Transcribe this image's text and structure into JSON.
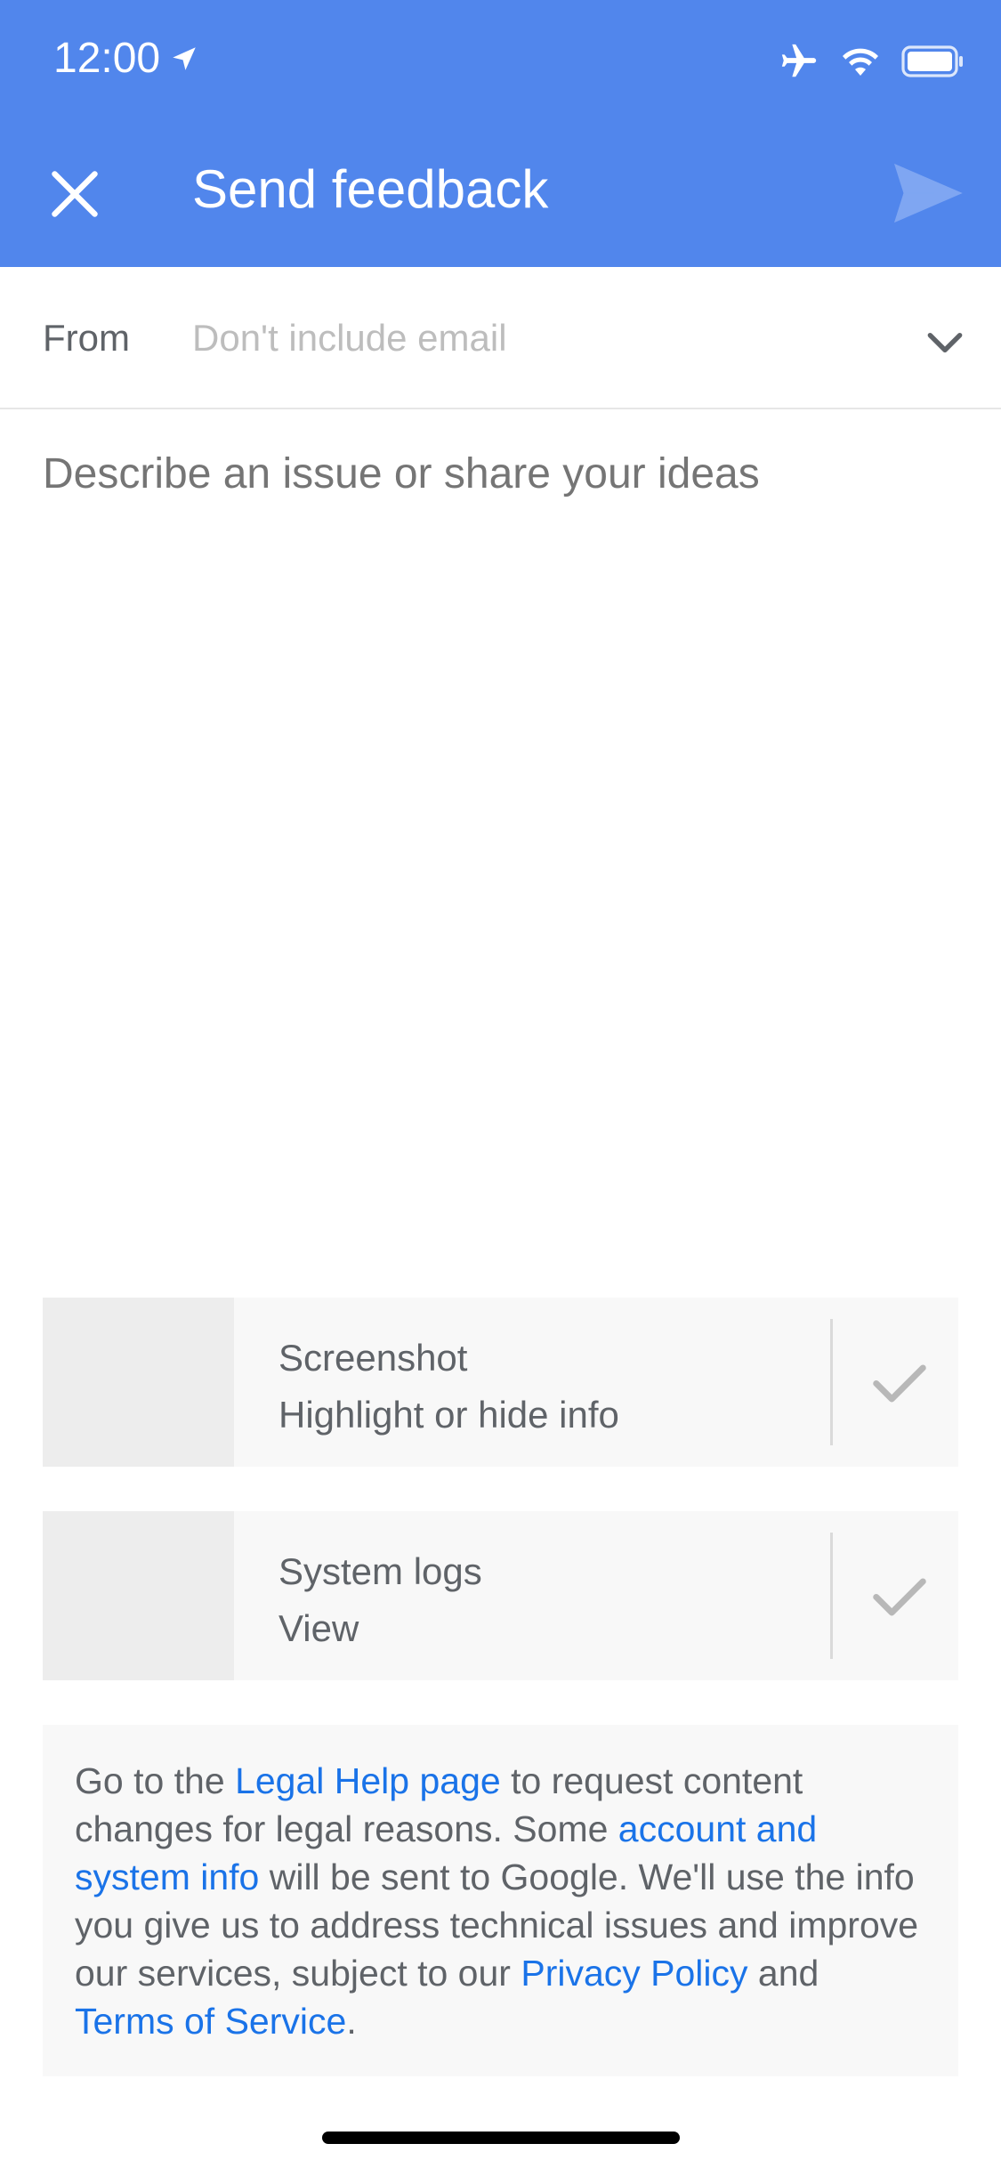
{
  "status_bar": {
    "time": "12:00"
  },
  "header": {
    "title": "Send feedback",
    "close_icon": "close-icon",
    "send_icon": "send-icon",
    "color": "#5186ec"
  },
  "from": {
    "label": "From",
    "value": "Don't include email"
  },
  "description": {
    "placeholder": "Describe an issue or share your ideas"
  },
  "attachments": [
    {
      "title": "Screenshot",
      "subtitle": "Highlight or hide info",
      "checked": true
    },
    {
      "title": "System logs",
      "subtitle": "View",
      "checked": true
    }
  ],
  "legal": {
    "t1": "Go to the ",
    "l1": "Legal Help page",
    "t2": " to request content changes for legal reasons. Some ",
    "l2": "account and system info",
    "t3": " will be sent to Google. We'll use the info you give us to address technical issues and improve our services, subject to our ",
    "l3": "Privacy Policy",
    "t4": " and ",
    "l4": "Terms of Service",
    "t5": "."
  },
  "colors": {
    "link": "#1a73e8",
    "panel": "#f8f8f8"
  }
}
